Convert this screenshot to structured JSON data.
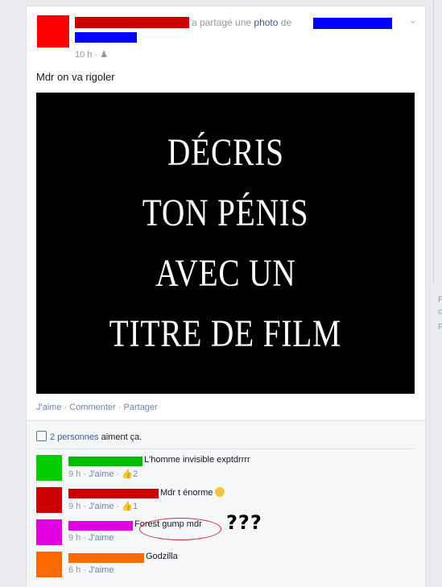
{
  "post": {
    "shared_text": "a partagé une",
    "photo_link": "photo",
    "de_text": "de",
    "time": "10 h",
    "audience_icon": "friends-icon",
    "body": "Mdr on va rigoler",
    "photo_lines": [
      "DÉCRIS",
      "TON PÉNIS",
      "AVEC UN",
      "TITRE DE FILM"
    ]
  },
  "actions": {
    "like": "J'aime",
    "comment": "Commenter",
    "share": "Partager",
    "separator": "·"
  },
  "likes": {
    "count_text": "2 personnes",
    "suffix": "aiment ça."
  },
  "comments": [
    {
      "text": "L'homme invisible exptdrrrr",
      "time": "9 h",
      "like": "J'aime",
      "likes_count": "2",
      "avatar_color": "#00cc00",
      "name_color": "#00bb00"
    },
    {
      "text": "Mdr t énorme",
      "time": "9 h",
      "like": "J'aime",
      "likes_count": "1",
      "avatar_color": "#cc0000",
      "name_color": "#cc0000"
    },
    {
      "text": "Forest gump mdr",
      "time": "9 h",
      "like": "J'aime",
      "avatar_color": "#e000e0",
      "name_color": "#e000e0"
    },
    {
      "text": "Godzilla",
      "time": "6 h",
      "like": "J'aime",
      "avatar_color": "#ff6a00",
      "name_color": "#ff6a00"
    }
  ],
  "annotation": {
    "question_marks": "???"
  },
  "colors": {
    "author_avatar": "#ff0000",
    "author_redact": "#cc0000",
    "page_redact": "#0000ff",
    "link": "#3b5998",
    "annotation_circle": "#dd2233"
  },
  "sidebar": {
    "frag1": "F",
    "frag2": "c",
    "frag3": "F"
  }
}
